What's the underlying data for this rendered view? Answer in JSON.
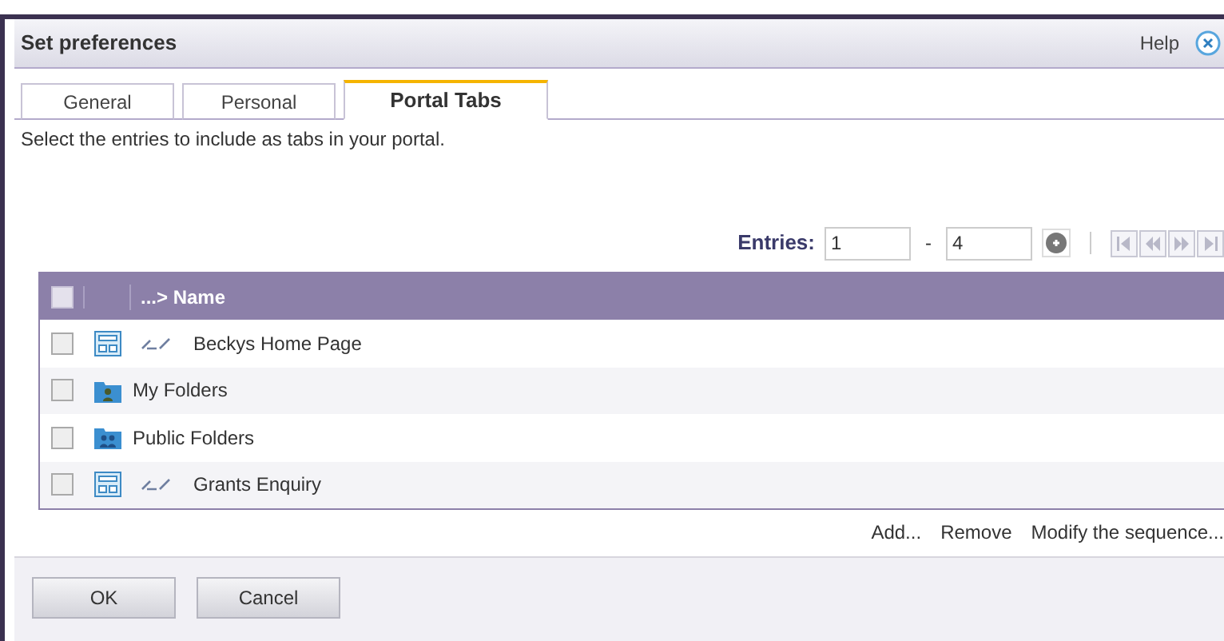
{
  "window": {
    "title": "Set preferences",
    "help": "Help"
  },
  "tabs": [
    {
      "label": "General",
      "selected": false
    },
    {
      "label": "Personal",
      "selected": false
    },
    {
      "label": "Portal Tabs",
      "selected": true
    }
  ],
  "description": "Select the entries to include as tabs in your portal.",
  "entries": {
    "label": "Entries:",
    "from": "1",
    "separator": "-",
    "to": "4"
  },
  "table": {
    "select_all_checked": false,
    "columns": [
      "...> Name"
    ],
    "rows": [
      {
        "kind": "page",
        "name": "Beckys Home Page",
        "checked": false
      },
      {
        "kind": "personal-folder",
        "name": "My Folders",
        "checked": false
      },
      {
        "kind": "public-folder",
        "name": "Public Folders",
        "checked": false
      },
      {
        "kind": "page",
        "name": "Grants Enquiry",
        "checked": false
      }
    ]
  },
  "actions": [
    "Add...",
    "Remove",
    "Modify the sequence..."
  ],
  "buttons": [
    "OK",
    "Cancel"
  ]
}
